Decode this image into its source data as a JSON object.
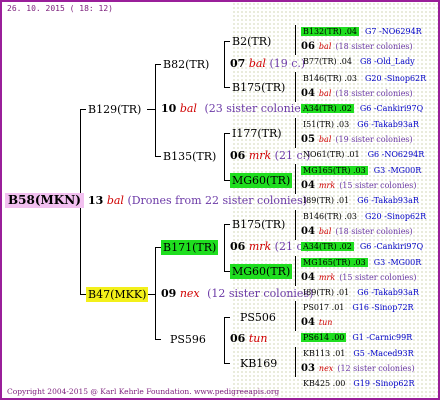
{
  "date": "26. 10. 2015 ( 18: 12)",
  "copyright": "Copyright 2004-2015 @ Karl Kehrle Foundation.   www.pedigreeapis.org",
  "root": {
    "name": "B58(MKN)",
    "num": "13",
    "mark": "bal",
    "sisters": "(Drones from 22 sister colonies)"
  },
  "gen1": [
    {
      "name": "B129(TR)",
      "num": "10",
      "mark": "bal",
      "sisters": "(23 sister colonies)"
    },
    {
      "name": "B47(MKK)",
      "num": "09",
      "mark": "nex",
      "sisters": "(12 sister colonies)"
    }
  ],
  "gen2": [
    {
      "name": "B82(TR)",
      "num": "07",
      "mark": "bal",
      "sisters": "(19 c.)"
    },
    {
      "name": "B135(TR)",
      "num": "06",
      "mark": "mrk",
      "sisters": "(21 c.)"
    },
    {
      "name": "B171(TR)",
      "num": "06",
      "mark": "mrk",
      "sisters": "(21 c.)"
    },
    {
      "name": "PS596",
      "num": "06",
      "mark": "tun",
      "sisters": ""
    }
  ],
  "gen3": [
    "B2(TR)",
    "B175(TR)",
    "I177(TR)",
    "MG60(TR)",
    "B175(TR)",
    "MG60(TR)",
    "PS506",
    "KB169"
  ],
  "gen4": [
    {
      "name": "B132(TR) .04",
      "ref": "G7 -NO6294R"
    },
    {
      "num": "06",
      "mark": "bal",
      "sisters": "(18 sister colonies)"
    },
    {
      "name": "B77(TR) .04",
      "ref": "G8 -Old_Lady"
    },
    {
      "name": "B146(TR) .03",
      "ref": "G20 -Sinop62R"
    },
    {
      "num": "04",
      "mark": "bal",
      "sisters": "(18 sister colonies)"
    },
    {
      "name": "A34(TR) .02",
      "ref": "G6 -Cankiri97Q"
    },
    {
      "name": "I51(TR) .03",
      "ref": "G6 -Takab93aR"
    },
    {
      "num": "05",
      "mark": "bal",
      "sisters": "(19 sister colonies)"
    },
    {
      "name": "NO61(TR) .01",
      "ref": "G6 -NO6294R"
    },
    {
      "name": "MG165(TR) .03",
      "ref": "G3 -MG00R"
    },
    {
      "num": "04",
      "mark": "mrk",
      "sisters": "(15 sister colonies)"
    },
    {
      "name": "I89(TR) .01",
      "ref": "G6 -Takab93aR"
    },
    {
      "name": "B146(TR) .03",
      "ref": "G20 -Sinop62R"
    },
    {
      "num": "04",
      "mark": "bal",
      "sisters": "(18 sister colonies)"
    },
    {
      "name": "A34(TR) .02",
      "ref": "G6 -Cankiri97Q"
    },
    {
      "name": "MG165(TR) .03",
      "ref": "G3 -MG00R"
    },
    {
      "num": "04",
      "mark": "mrk",
      "sisters": "(15 sister colonies)"
    },
    {
      "name": "I89(TR) .01",
      "ref": "G6 -Takab93aR"
    },
    {
      "name": "PS017 .01",
      "ref": "G16 -Sinop72R"
    },
    {
      "num": "04",
      "mark": "tun",
      "sisters": ""
    },
    {
      "name": "PS614 .00",
      "ref": "G1 -Carnic99R"
    },
    {
      "name": "KB113 .01",
      "ref": "G5 -Maced93R"
    },
    {
      "num": "03",
      "mark": "nex",
      "sisters": "(12 sister colonies)"
    },
    {
      "name": "KB425 .00",
      "ref": "G19 -Sinop62R"
    }
  ]
}
